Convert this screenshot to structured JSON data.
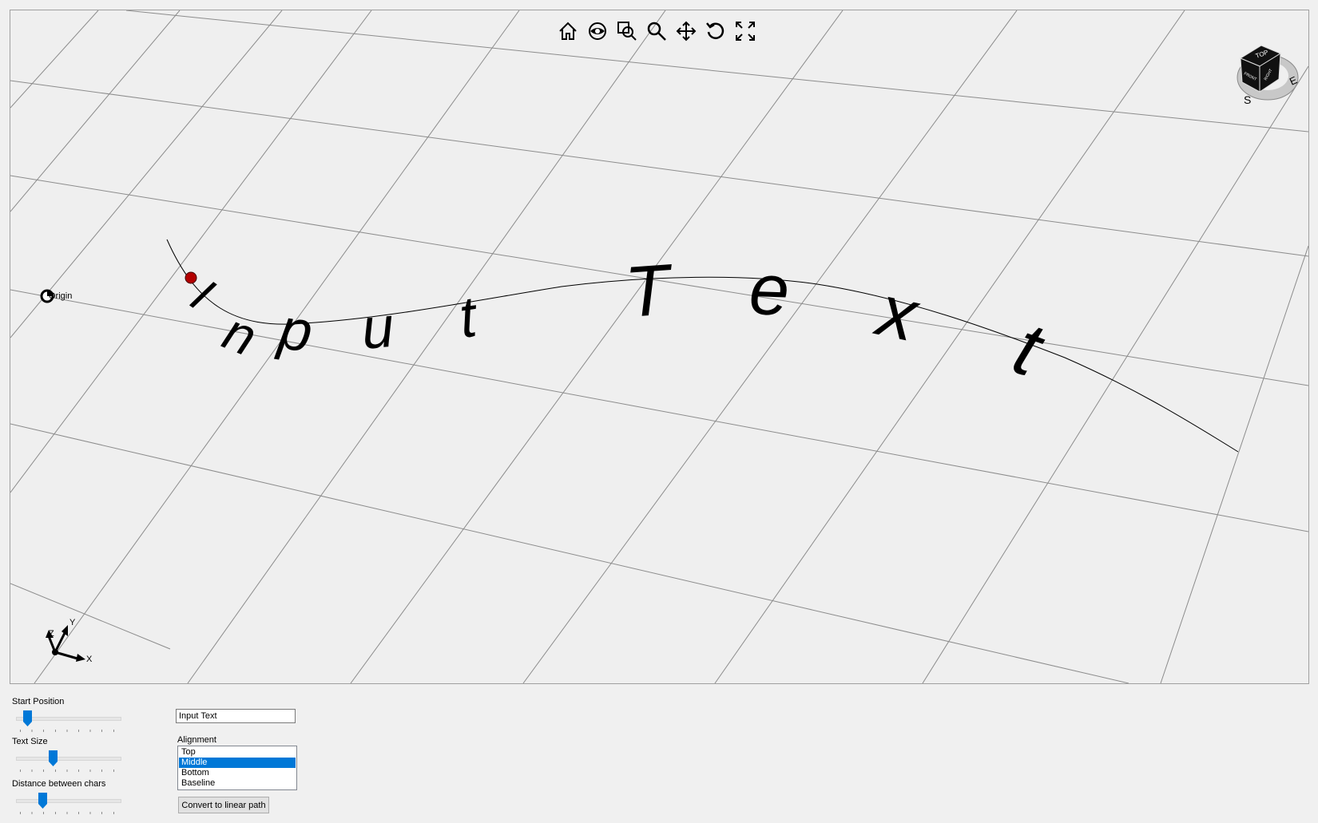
{
  "viewport": {
    "origin_label": "Origin",
    "path_text": "Input Text",
    "toolbar": [
      {
        "name": "home-button",
        "icon": "home-icon"
      },
      {
        "name": "view-button",
        "icon": "eye-icon"
      },
      {
        "name": "zoom-window-button",
        "icon": "zoom-window-icon"
      },
      {
        "name": "zoom-button",
        "icon": "magnifier-icon"
      },
      {
        "name": "pan-button",
        "icon": "move-arrows-icon"
      },
      {
        "name": "rotate-button",
        "icon": "rotate-icon"
      },
      {
        "name": "zoom-extents-button",
        "icon": "fullscreen-icon"
      }
    ],
    "navcube": {
      "top": "TOP",
      "front": "FRONT",
      "right": "RIGHT",
      "south": "S",
      "east": "E"
    },
    "axes": {
      "x": "X",
      "y": "Y",
      "z": "Z"
    },
    "colors": {
      "background": "#efefef",
      "grid": "#8c8c8c",
      "marker": "#c00000"
    }
  },
  "controls": {
    "start_position": {
      "label": "Start Position",
      "value": 0.1
    },
    "text_size": {
      "label": "Text Size",
      "value": 0.35
    },
    "char_distance": {
      "label": "Distance between chars",
      "value": 0.25
    },
    "text_input_value": "Input Text",
    "alignment": {
      "label": "Alignment",
      "options": [
        "Top",
        "Middle",
        "Bottom",
        "Baseline"
      ],
      "selected": "Middle"
    },
    "convert_button_label": "Convert to linear path"
  }
}
